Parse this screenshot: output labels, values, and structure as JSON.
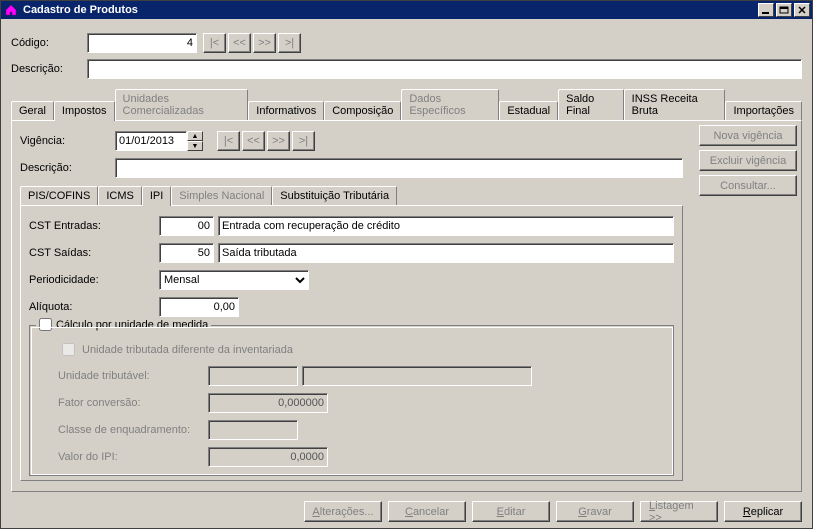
{
  "window": {
    "title": "Cadastro de Produtos"
  },
  "top": {
    "codigo_label": "Código:",
    "codigo_value": "4",
    "descricao_label": "Descrição:",
    "descricao_value": ""
  },
  "main_tabs": [
    {
      "label": "Geral",
      "active": false,
      "disabled": false
    },
    {
      "label": "Impostos",
      "active": true,
      "disabled": false
    },
    {
      "label": "Unidades Comercializadas",
      "active": false,
      "disabled": true
    },
    {
      "label": "Informativos",
      "active": false,
      "disabled": false
    },
    {
      "label": "Composição",
      "active": false,
      "disabled": false
    },
    {
      "label": "Dados Específicos",
      "active": false,
      "disabled": true
    },
    {
      "label": "Estadual",
      "active": false,
      "disabled": false
    },
    {
      "label": "Saldo Final",
      "active": false,
      "disabled": false
    },
    {
      "label": "INSS Receita Bruta",
      "active": false,
      "disabled": false
    },
    {
      "label": "Importações",
      "active": false,
      "disabled": false
    }
  ],
  "impostos": {
    "vigencia_label": "Vigência:",
    "vigencia_value": "01/01/2013",
    "descricao_label": "Descrição:",
    "descricao_value": ""
  },
  "right_buttons": {
    "nova": "Nova vigência",
    "excluir": "Excluir vigência",
    "consultar": "Consultar..."
  },
  "sub_tabs": [
    {
      "label": "PIS/COFINS",
      "active": false,
      "disabled": false
    },
    {
      "label": "ICMS",
      "active": false,
      "disabled": false
    },
    {
      "label": "IPI",
      "active": true,
      "disabled": false
    },
    {
      "label": "Simples Nacional",
      "active": false,
      "disabled": true
    },
    {
      "label": "Substituição Tributária",
      "active": false,
      "disabled": false
    }
  ],
  "ipi": {
    "cst_ent_label": "CST Entradas:",
    "cst_ent_code": "00",
    "cst_ent_desc": "Entrada com recuperação de crédito",
    "cst_sai_label": "CST Saídas:",
    "cst_sai_code": "50",
    "cst_sai_desc": "Saída tributada",
    "period_label": "Periodicidade:",
    "period_value": "Mensal",
    "aliquota_label": "Alíquota:",
    "aliquota_value": "0,00",
    "fs_title": "Cálculo por unidade de medida",
    "chk_invent": "Unidade tributada diferente da inventariada",
    "unid_label": "Unidade tributável:",
    "unid_code": "",
    "unid_desc": "",
    "fator_label": "Fator conversão:",
    "fator_value": "0,000000",
    "classe_label": "Classe de enquadramento:",
    "classe_value": "",
    "valoripi_label": "Valor do IPI:",
    "valoripi_value": "0,0000"
  },
  "footer": {
    "alteracoes": "Alterações...",
    "cancelar": "Cancelar",
    "editar": "Editar",
    "gravar": "Gravar",
    "listagem": "Listagem >>",
    "replicar": "Replicar"
  },
  "nav_glyphs": {
    "first": "|<",
    "prev": "<<",
    "next": ">>",
    "last": ">|"
  }
}
